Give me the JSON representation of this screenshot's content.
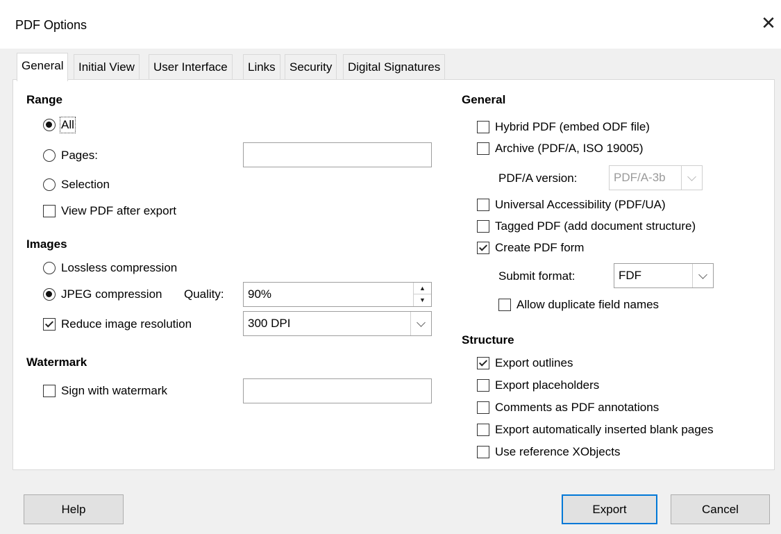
{
  "window": {
    "title": "PDF Options"
  },
  "tabs": [
    "General",
    "Initial View",
    "User Interface",
    "Links",
    "Security",
    "Digital Signatures"
  ],
  "range": {
    "heading": "Range",
    "all_label": "All",
    "pages_label": "Pages:",
    "pages_value": "",
    "selection_label": "Selection",
    "view_pdf_label": "View PDF after export",
    "selected": "All"
  },
  "images": {
    "heading": "Images",
    "lossless_label": "Lossless compression",
    "jpeg_label": "JPEG compression",
    "quality_label": "Quality:",
    "quality_value": "90%",
    "reduce_label": "Reduce image resolution",
    "reduce_checked": true,
    "resolution_value": "300 DPI",
    "selected": "JPEG compression"
  },
  "watermark": {
    "heading": "Watermark",
    "sign_label": "Sign with watermark",
    "sign_value": ""
  },
  "general": {
    "heading": "General",
    "hybrid_label": "Hybrid PDF (embed ODF file)",
    "archive_label": "Archive (PDF/A, ISO 19005)",
    "pdfa_version_label": "PDF/A version:",
    "pdfa_version_value": "PDF/A-3b",
    "universal_label": "Universal Accessibility (PDF/UA)",
    "tagged_label": "Tagged PDF (add document structure)",
    "create_form_label": "Create PDF form",
    "create_form_checked": true,
    "submit_format_label": "Submit format:",
    "submit_format_value": "FDF",
    "allow_duplicate_label": "Allow duplicate field names"
  },
  "structure": {
    "heading": "Structure",
    "export_outlines_label": "Export outlines",
    "export_outlines_checked": true,
    "export_placeholders_label": "Export placeholders",
    "comments_label": "Comments as PDF annotations",
    "blank_pages_label": "Export automatically inserted blank pages",
    "reference_xobjects_label": "Use reference XObjects"
  },
  "buttons": {
    "help": "Help",
    "export": "Export",
    "cancel": "Cancel"
  }
}
